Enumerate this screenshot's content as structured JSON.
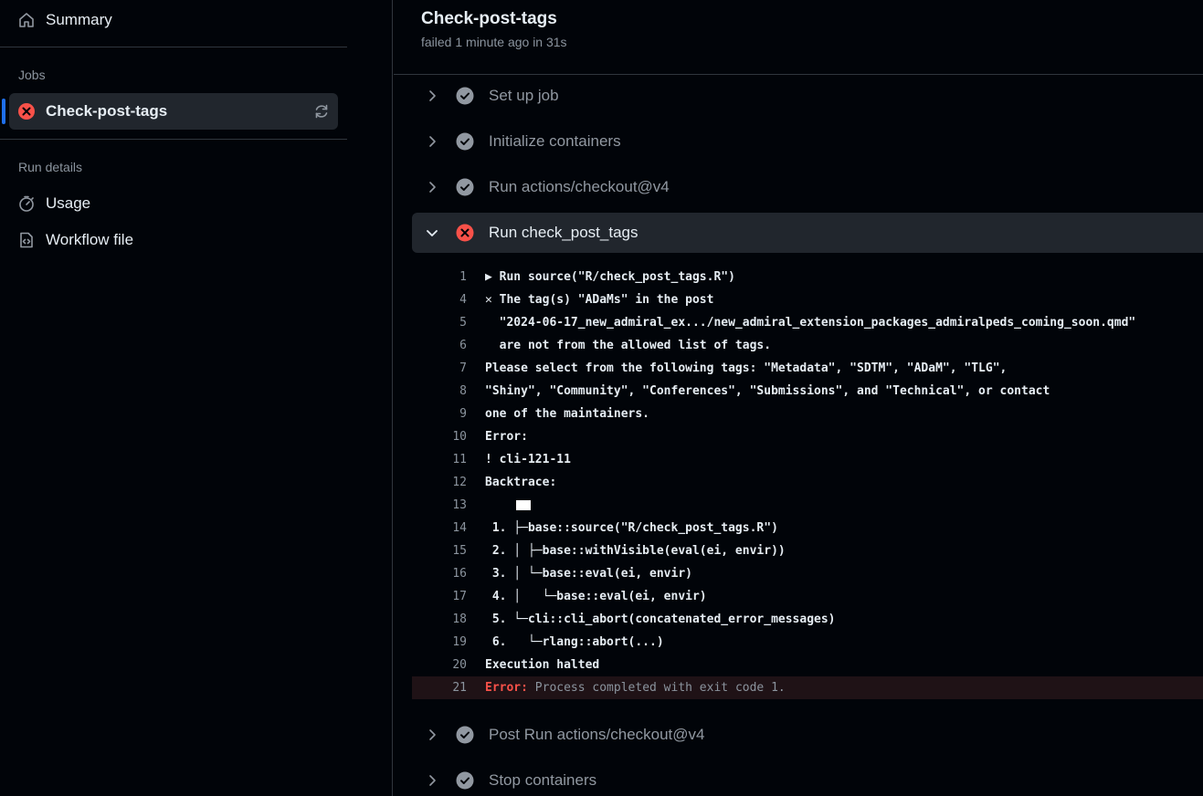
{
  "sidebar": {
    "summary_label": "Summary",
    "jobs_label": "Jobs",
    "job": {
      "label": "Check-post-tags",
      "status": "failed"
    },
    "run_details_label": "Run details",
    "usage_label": "Usage",
    "workflow_file_label": "Workflow file"
  },
  "header": {
    "title": "Check-post-tags",
    "subtitle": "failed 1 minute ago in 31s"
  },
  "steps_before": [
    {
      "label": "Set up job",
      "status": "success"
    },
    {
      "label": "Initialize containers",
      "status": "success"
    },
    {
      "label": "Run actions/checkout@v4",
      "status": "success"
    }
  ],
  "expanded_step": {
    "label": "Run check_post_tags",
    "status": "failure"
  },
  "log_lines": [
    {
      "n": "1",
      "text": "▶ Run source(\"R/check_post_tags.R\")"
    },
    {
      "n": "4",
      "text": "✕ The tag(s) \"ADaMs\" in the post"
    },
    {
      "n": "5",
      "text": "  \"2024-06-17_new_admiral_ex.../new_admiral_extension_packages_admiralpeds_coming_soon.qmd\""
    },
    {
      "n": "6",
      "text": "  are not from the allowed list of tags."
    },
    {
      "n": "7",
      "text": "Please select from the following tags: \"Metadata\", \"SDTM\", \"ADaM\", \"TLG\","
    },
    {
      "n": "8",
      "text": "\"Shiny\", \"Community\", \"Conferences\", \"Submissions\", and \"Technical\", or contact"
    },
    {
      "n": "9",
      "text": "one of the maintainers."
    },
    {
      "n": "10",
      "text": "Error:"
    },
    {
      "n": "11",
      "text": "! cli-121-11"
    },
    {
      "n": "12",
      "text": "Backtrace:"
    },
    {
      "n": "13",
      "text": ""
    },
    {
      "n": "14",
      "text": " 1. ├─base::source(\"R/check_post_tags.R\")"
    },
    {
      "n": "15",
      "text": " 2. │ ├─base::withVisible(eval(ei, envir))"
    },
    {
      "n": "16",
      "text": " 3. │ └─base::eval(ei, envir)"
    },
    {
      "n": "17",
      "text": " 4. │   └─base::eval(ei, envir)"
    },
    {
      "n": "18",
      "text": " 5. └─cli::cli_abort(concatenated_error_messages)"
    },
    {
      "n": "19",
      "text": " 6.   └─rlang::abort(...)"
    },
    {
      "n": "20",
      "text": "Execution halted"
    }
  ],
  "error_line": {
    "n": "21",
    "label": "Error:",
    "message": " Process completed with exit code 1."
  },
  "steps_after": [
    {
      "label": "Post Run actions/checkout@v4",
      "status": "success"
    },
    {
      "label": "Stop containers",
      "status": "success"
    }
  ],
  "colors": {
    "accent": "#1f6feb",
    "failure": "#f85149",
    "success_icon": "#9198a1",
    "background": "#010409",
    "panel": "#21262d"
  }
}
